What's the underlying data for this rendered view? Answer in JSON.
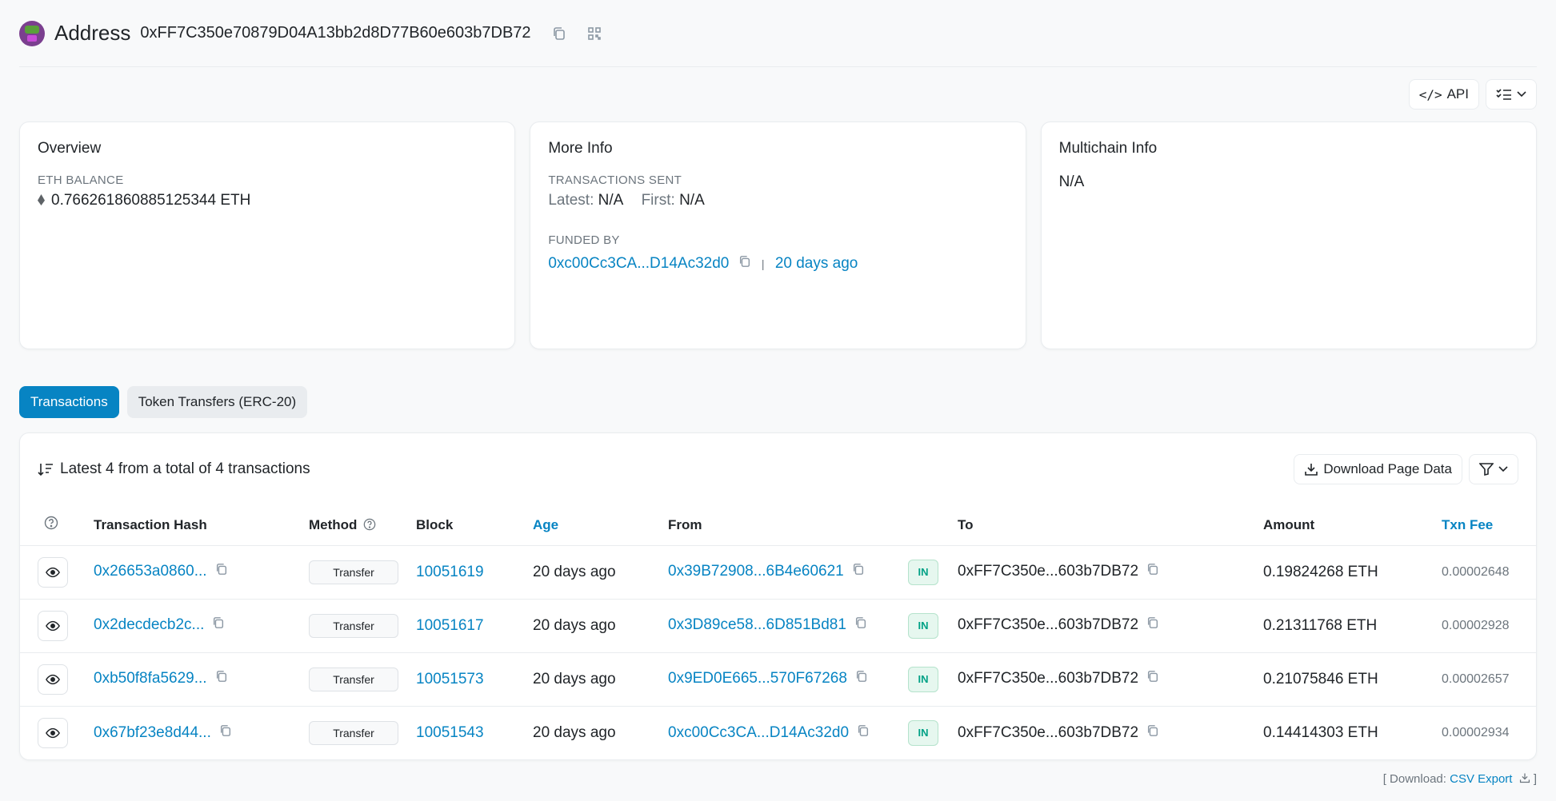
{
  "header": {
    "title": "Address",
    "address": "0xFF7C350e70879D04A13bb2d8D77B60e603b7DB72"
  },
  "toolbar": {
    "api_label": "API"
  },
  "overview": {
    "title": "Overview",
    "balance_label": "ETH BALANCE",
    "balance_value": "0.766261860885125344 ETH"
  },
  "more_info": {
    "title": "More Info",
    "tx_sent_label": "TRANSACTIONS SENT",
    "latest_label": "Latest:",
    "latest_value": "N/A",
    "first_label": "First:",
    "first_value": "N/A",
    "funded_label": "FUNDED BY",
    "funded_addr": "0xc00Cc3CA...D14Ac32d0",
    "separator": "|",
    "funded_age": "20 days ago"
  },
  "multichain": {
    "title": "Multichain Info",
    "value": "N/A"
  },
  "tabs": [
    {
      "label": "Transactions",
      "active": true
    },
    {
      "label": "Token Transfers (ERC-20)",
      "active": false
    }
  ],
  "table": {
    "summary": "Latest 4 from a total of 4 transactions",
    "download_label": "Download Page Data",
    "columns": {
      "hash": "Transaction Hash",
      "method": "Method",
      "block": "Block",
      "age": "Age",
      "from": "From",
      "to": "To",
      "amount": "Amount",
      "fee": "Txn Fee"
    },
    "rows": [
      {
        "hash": "0x26653a0860...",
        "method": "Transfer",
        "block": "10051619",
        "age": "20 days ago",
        "from": "0x39B72908...6B4e60621",
        "dir": "IN",
        "to": "0xFF7C350e...603b7DB72",
        "amount": "0.19824268 ETH",
        "fee": "0.00002648"
      },
      {
        "hash": "0x2decdecb2c...",
        "method": "Transfer",
        "block": "10051617",
        "age": "20 days ago",
        "from": "0x3D89ce58...6D851Bd81",
        "dir": "IN",
        "to": "0xFF7C350e...603b7DB72",
        "amount": "0.21311768 ETH",
        "fee": "0.00002928"
      },
      {
        "hash": "0xb50f8fa5629...",
        "method": "Transfer",
        "block": "10051573",
        "age": "20 days ago",
        "from": "0x9ED0E665...570F67268",
        "dir": "IN",
        "to": "0xFF7C350e...603b7DB72",
        "amount": "0.21075846 ETH",
        "fee": "0.00002657"
      },
      {
        "hash": "0x67bf23e8d44...",
        "method": "Transfer",
        "block": "10051543",
        "age": "20 days ago",
        "from": "0xc00Cc3CA...D14Ac32d0",
        "dir": "IN",
        "to": "0xFF7C350e...603b7DB72",
        "amount": "0.14414303 ETH",
        "fee": "0.00002934"
      }
    ]
  },
  "footer": {
    "prefix": "[ Download:",
    "link": "CSV Export",
    "suffix": "]"
  }
}
